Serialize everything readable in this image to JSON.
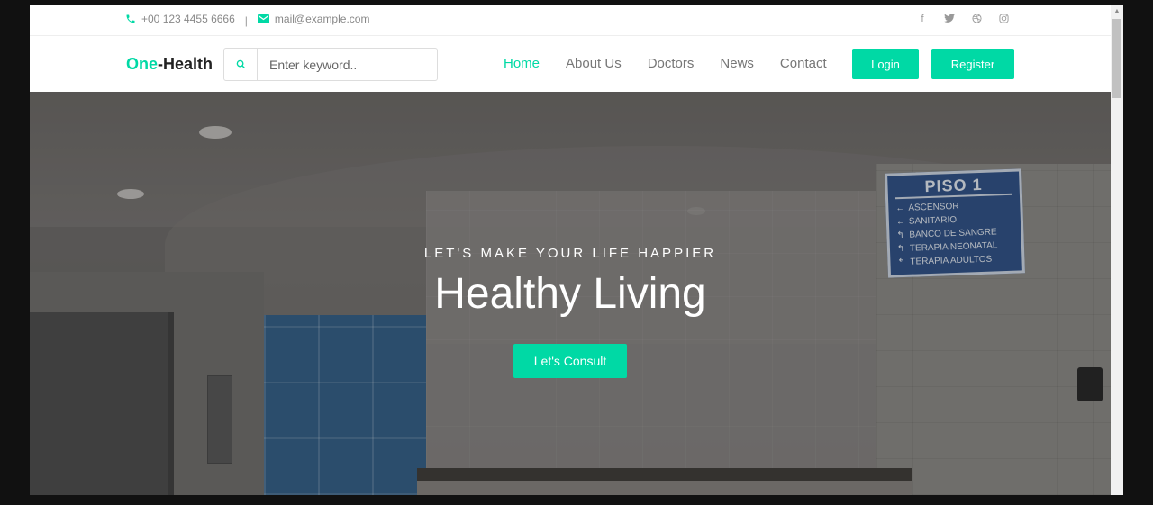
{
  "topbar": {
    "phone": "+00 123 4455 6666",
    "separator": "|",
    "email": "mail@example.com",
    "socials": [
      "facebook-icon",
      "twitter-icon",
      "dribbble-icon",
      "instagram-icon"
    ]
  },
  "brand": {
    "part1": "One",
    "part2": "-Health"
  },
  "search": {
    "placeholder": "Enter keyword.."
  },
  "nav": {
    "items": [
      "Home",
      "About Us",
      "Doctors",
      "News",
      "Contact"
    ],
    "active": "Home"
  },
  "auth": {
    "login_label": "Login",
    "register_label": "Register"
  },
  "hero": {
    "subtitle": "LET'S MAKE YOUR LIFE HAPPIER",
    "title": "Healthy Living",
    "cta_label": "Let's Consult",
    "sign": {
      "title": "PISO 1",
      "items": [
        "ASCENSOR",
        "SANITARIO",
        "BANCO DE SANGRE",
        "TERAPIA NEONATAL",
        "TERAPIA ADULTOS"
      ]
    }
  },
  "colors": {
    "accent": "#00d9a5",
    "text_muted": "#777777"
  }
}
